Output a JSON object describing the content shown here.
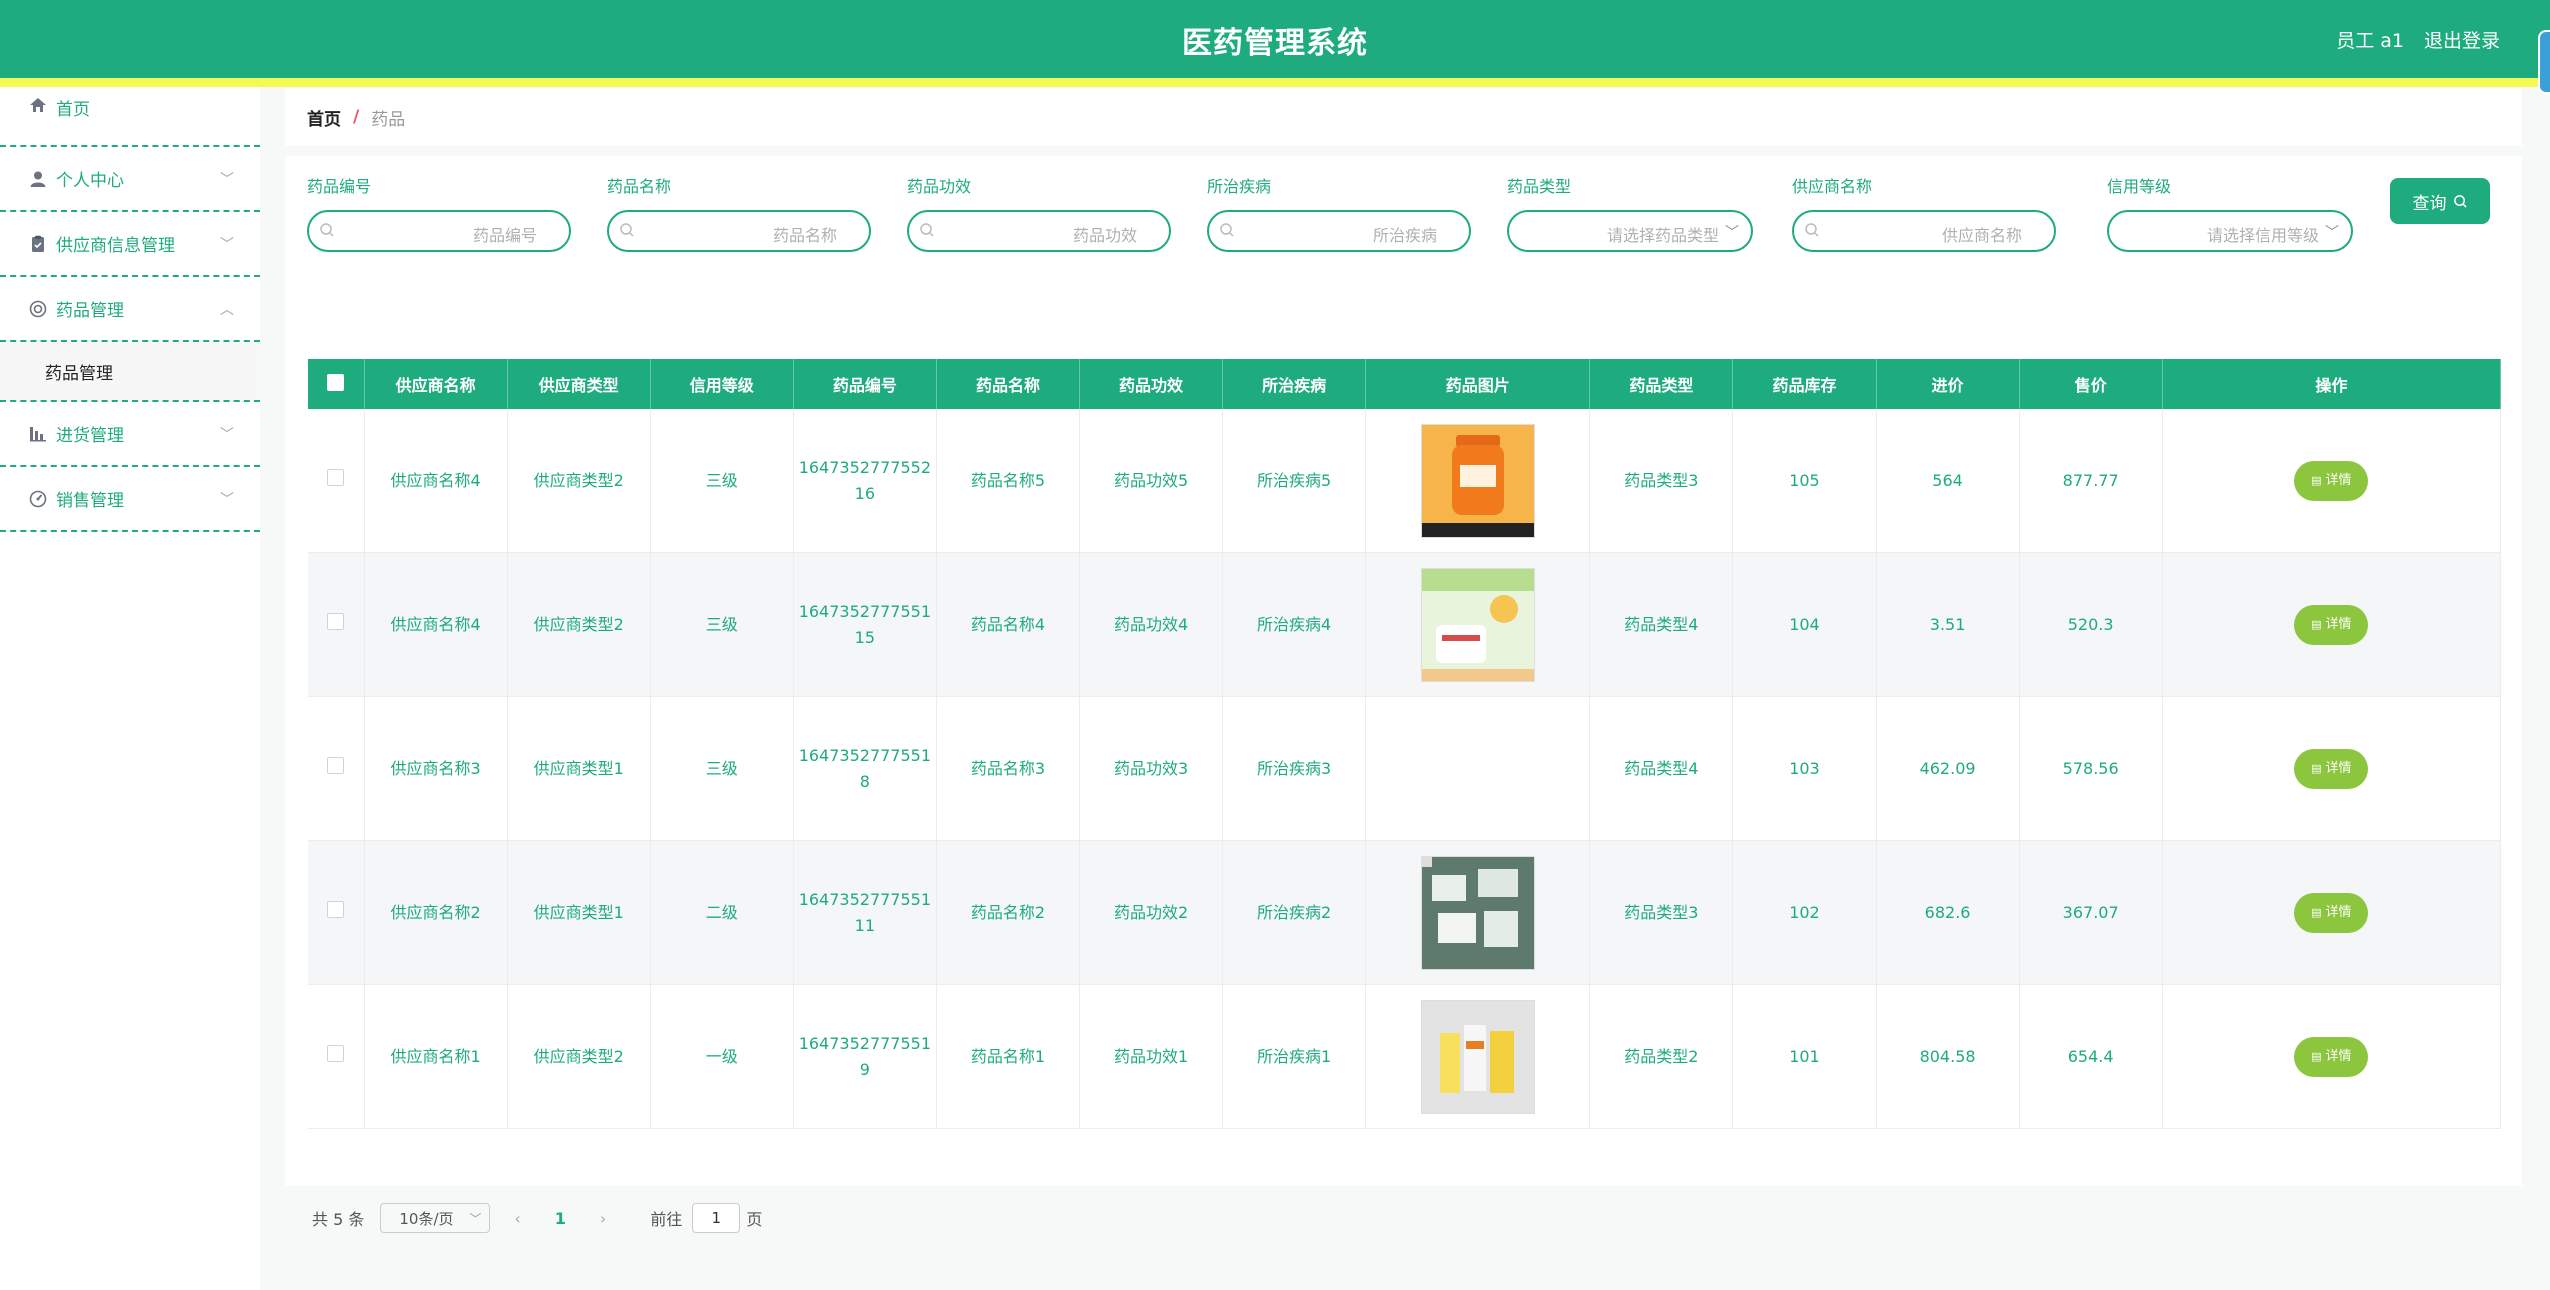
{
  "header": {
    "title": "医药管理系统",
    "user": "员工 a1",
    "logout": "退出登录"
  },
  "sidebar": {
    "items": [
      {
        "label": "首页",
        "icon": "home-icon"
      },
      {
        "label": "个人中心",
        "icon": "user-icon"
      },
      {
        "label": "供应商信息管理",
        "icon": "clipboard-icon"
      },
      {
        "label": "药品管理",
        "icon": "pill-icon"
      },
      {
        "label": "进货管理",
        "icon": "chart-icon"
      },
      {
        "label": "销售管理",
        "icon": "gauge-icon"
      }
    ],
    "submenu": "药品管理"
  },
  "breadcrumb": {
    "home": "首页",
    "sep": "/",
    "current": "药品"
  },
  "filters": [
    {
      "label": "药品编号",
      "placeholder": "药品编号"
    },
    {
      "label": "药品名称",
      "placeholder": "药品名称"
    },
    {
      "label": "药品功效",
      "placeholder": "药品功效"
    },
    {
      "label": "所治疾病",
      "placeholder": "所治疾病"
    },
    {
      "label": "药品类型",
      "placeholder": "请选择药品类型"
    },
    {
      "label": "供应商名称",
      "placeholder": "供应商名称"
    },
    {
      "label": "信用等级",
      "placeholder": "请选择信用等级"
    }
  ],
  "query_label": "查询",
  "table": {
    "headers": [
      "供应商名称",
      "供应商类型",
      "信用等级",
      "药品编号",
      "药品名称",
      "药品功效",
      "所治疾病",
      "药品图片",
      "药品类型",
      "药品库存",
      "进价",
      "售价",
      "操作"
    ],
    "detail_label": "详情",
    "rows": [
      {
        "c0": "供应商名称4",
        "c1": "供应商类型2",
        "c2": "三级",
        "c3a": "1647352777552",
        "c3b": "16",
        "c4": "药品名称5",
        "c5": "药品功效5",
        "c6": "所治疾病5",
        "img": "orange",
        "c8": "药品类型3",
        "c9": "105",
        "c10": "564",
        "c11": "877.77"
      },
      {
        "c0": "供应商名称4",
        "c1": "供应商类型2",
        "c2": "三级",
        "c3a": "1647352777551",
        "c3b": "15",
        "c4": "药品名称4",
        "c5": "药品功效4",
        "c6": "所治疾病4",
        "img": "vitc",
        "c8": "药品类型4",
        "c9": "104",
        "c10": "3.51",
        "c11": "520.3"
      },
      {
        "c0": "供应商名称3",
        "c1": "供应商类型1",
        "c2": "三级",
        "c3a": "1647352777551",
        "c3b": "8",
        "c4": "药品名称3",
        "c5": "药品功效3",
        "c6": "所治疾病3",
        "img": "none",
        "c8": "药品类型4",
        "c9": "103",
        "c10": "462.09",
        "c11": "578.56"
      },
      {
        "c0": "供应商名称2",
        "c1": "供应商类型1",
        "c2": "二级",
        "c3a": "1647352777551",
        "c3b": "11",
        "c4": "药品名称2",
        "c5": "药品功效2",
        "c6": "所治疾病2",
        "img": "boxes",
        "c8": "药品类型3",
        "c9": "102",
        "c10": "682.6",
        "c11": "367.07"
      },
      {
        "c0": "供应商名称1",
        "c1": "供应商类型2",
        "c2": "一级",
        "c3a": "1647352777551",
        "c3b": "9",
        "c4": "药品名称1",
        "c5": "药品功效1",
        "c6": "所治疾病1",
        "img": "yellow",
        "c8": "药品类型2",
        "c9": "101",
        "c10": "804.58",
        "c11": "654.4"
      }
    ]
  },
  "pager": {
    "total": "共 5 条",
    "size": "10条/页",
    "page": "1",
    "goto": "前往",
    "goto_value": "1",
    "unit": "页"
  }
}
